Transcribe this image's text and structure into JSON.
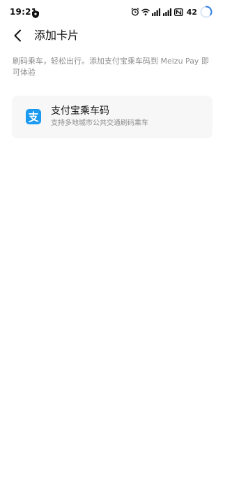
{
  "status_bar": {
    "time": "19:21",
    "battery_level": "42",
    "icons": [
      "shield-icon",
      "alarm-icon",
      "wifi-icon",
      "signal-icon",
      "signal-icon",
      "nfc-icon",
      "battery-ring-icon"
    ]
  },
  "header": {
    "back_icon": "chevron-left-icon",
    "title": "添加卡片"
  },
  "description": "刷码乘车，轻松出行。添加支付宝乘车码到 Meizu Pay 即可体验",
  "cards": [
    {
      "icon": "alipay-icon",
      "icon_glyph": "支",
      "title": "支付宝乘车码",
      "subtitle": "支持多地城市公共交通刷码乘车"
    }
  ],
  "colors": {
    "alipay_blue": "#1a9af0",
    "battery_ring": "#2f7fe0",
    "card_bg": "#f7f7f7",
    "secondary_text": "#8c8c8c"
  }
}
